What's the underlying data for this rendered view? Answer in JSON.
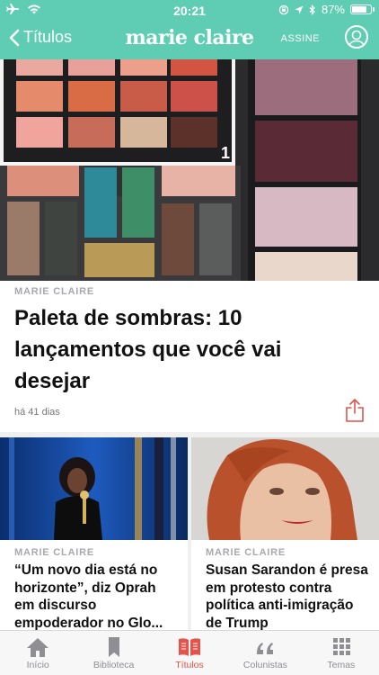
{
  "status_bar": {
    "time": "20:21",
    "battery_level": "87%",
    "battery_fraction": 0.87
  },
  "nav": {
    "back_label": "Títulos",
    "brand": "marie claire",
    "subscribe_label": "ASSINE"
  },
  "hero": {
    "source": "MARIE CLAIRE",
    "title": "Paleta de sombras: 10 lançamentos que você vai desejar",
    "date": "há 41 dias",
    "palette_number": "1"
  },
  "cards": [
    {
      "source": "MARIE CLAIRE",
      "title": "“Um novo dia está no horizonte”, diz Oprah em discurso empoderador no Glo..."
    },
    {
      "source": "MARIE CLAIRE",
      "title": "Susan Sarandon é presa em protesto contra política anti-imigração de Trump"
    }
  ],
  "tabs": [
    {
      "label": "Início",
      "icon": "home-icon",
      "active": false
    },
    {
      "label": "Biblioteca",
      "icon": "bookmark-icon",
      "active": false
    },
    {
      "label": "Títulos",
      "icon": "open-book-icon",
      "active": true
    },
    {
      "label": "Colunistas",
      "icon": "quote-icon",
      "active": false
    },
    {
      "label": "Temas",
      "icon": "grid-icon",
      "active": false
    }
  ],
  "colors": {
    "brand_teal": "#5fcdb3",
    "active_tab": "#e2544c",
    "kicker_gray": "#a9a9ad"
  }
}
